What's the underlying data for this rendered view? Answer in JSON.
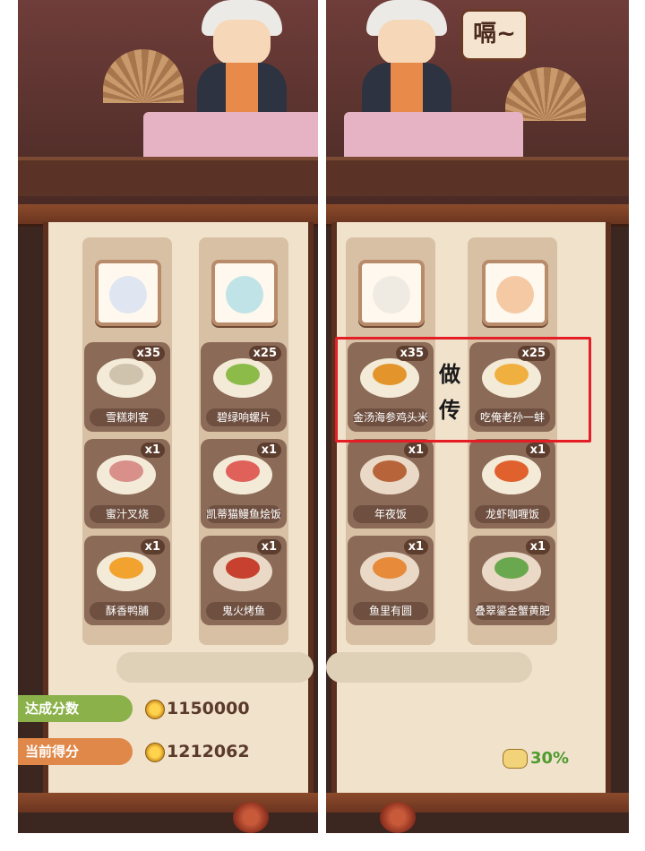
{
  "colors": {
    "target_tag": "#8bb24a",
    "current_tag": "#e0884a",
    "highlight": "#e41e24",
    "percent": "#4f9b2e"
  },
  "left_panel": {
    "columns": [
      {
        "dishes": [
          {
            "name": "雪糕刺客",
            "count": "x35"
          },
          {
            "name": "蜜汁叉烧",
            "count": "x1"
          },
          {
            "name": "酥香鸭脯",
            "count": "x1"
          }
        ]
      },
      {
        "dishes": [
          {
            "name": "碧绿响螺片",
            "count": "x25"
          },
          {
            "name": "凯蒂猫鳗鱼烩饭",
            "count": "x1"
          },
          {
            "name": "鬼火烤鱼",
            "count": "x1"
          }
        ]
      }
    ],
    "target_label": "达成分数",
    "target_score": "1150000",
    "current_label": "当前得分",
    "current_score": "1212062"
  },
  "right_panel": {
    "speech_bubble": "嗝~",
    "columns": [
      {
        "dishes": [
          {
            "name": "金汤海参鸡头米",
            "count": "x35"
          },
          {
            "name": "年夜饭",
            "count": "x1"
          },
          {
            "name": "鱼里有圆",
            "count": "x1"
          }
        ]
      },
      {
        "dishes": [
          {
            "name": "吃俺老孙一蚌",
            "count": "x25"
          },
          {
            "name": "龙虾咖喱饭",
            "count": "x1"
          },
          {
            "name": "叠翠鎏金蟹黄肥",
            "count": "x1"
          }
        ]
      }
    ],
    "handwritten_note": [
      "做",
      "传"
    ],
    "percent": "30%"
  }
}
